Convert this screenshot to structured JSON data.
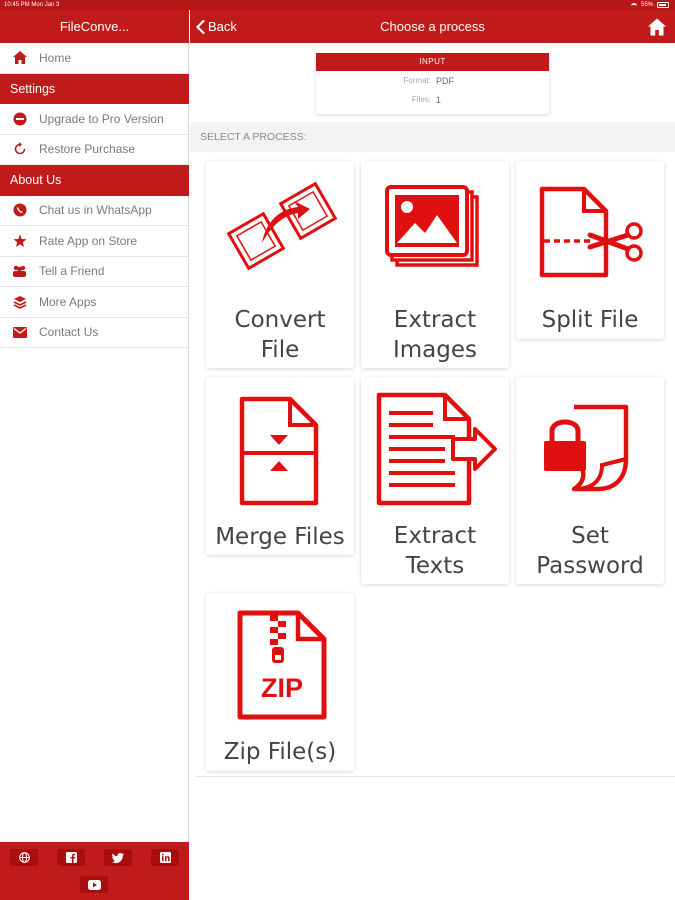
{
  "status_bar": {
    "time_date": "10:45 PM   Mon Jan 3",
    "battery": "55%"
  },
  "sidebar": {
    "title": "FileConve...",
    "items": [
      {
        "type": "item",
        "label": "Home",
        "icon": "home-icon"
      },
      {
        "type": "section",
        "label": "Settings"
      },
      {
        "type": "item",
        "label": "Upgrade to Pro Version",
        "icon": "upgrade-icon"
      },
      {
        "type": "item",
        "label": "Restore Purchase",
        "icon": "restore-icon"
      },
      {
        "type": "section",
        "label": "About Us"
      },
      {
        "type": "item",
        "label": "Chat us in WhatsApp",
        "icon": "whatsapp-icon"
      },
      {
        "type": "item",
        "label": "Rate App on Store",
        "icon": "star-icon"
      },
      {
        "type": "item",
        "label": "Tell a Friend",
        "icon": "people-icon"
      },
      {
        "type": "item",
        "label": "More Apps",
        "icon": "layers-icon"
      },
      {
        "type": "item",
        "label": "Contact Us",
        "icon": "mail-icon"
      }
    ],
    "social": [
      "globe-icon",
      "facebook-icon",
      "twitter-icon",
      "linkedin-icon",
      "youtube-icon"
    ]
  },
  "header": {
    "back_label": "Back",
    "title": "Choose a process"
  },
  "input_card": {
    "heading": "INPUT",
    "format_label": "Format:",
    "format_value": "PDF",
    "files_label": "Files:",
    "files_value": "1"
  },
  "section_label": "SELECT A PROCESS:",
  "processes": [
    {
      "id": "convert",
      "line1": "Convert",
      "line2": "File",
      "icon": "convert-file-icon"
    },
    {
      "id": "extract-images",
      "line1": "Extract",
      "line2": "Images",
      "icon": "extract-images-icon"
    },
    {
      "id": "split",
      "line1": "Split File",
      "line2": "",
      "icon": "split-file-icon"
    },
    {
      "id": "merge",
      "line1": "Merge Files",
      "line2": "",
      "icon": "merge-files-icon"
    },
    {
      "id": "extract-texts",
      "line1": "Extract",
      "line2": "Texts",
      "icon": "extract-texts-icon"
    },
    {
      "id": "password",
      "line1": "Set",
      "line2": "Password",
      "icon": "set-password-icon"
    },
    {
      "id": "zip",
      "line1": "Zip File(s)",
      "line2": "",
      "icon": "zip-file-icon",
      "icon_text": "ZIP"
    }
  ],
  "colors": {
    "accent": "#c11a1a",
    "icon_red": "#e01010"
  }
}
